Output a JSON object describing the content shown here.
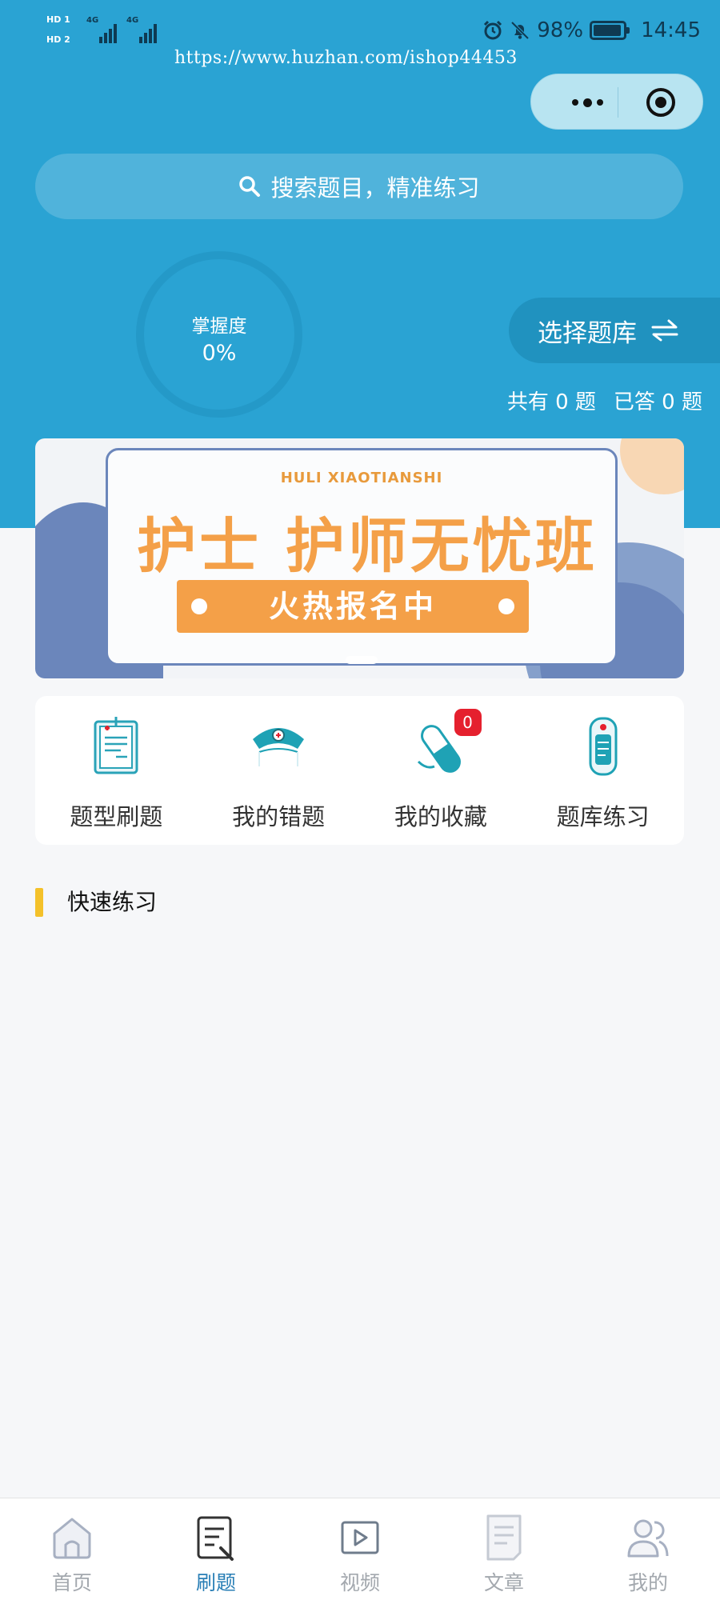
{
  "status_bar": {
    "hd1": "HD 1",
    "hd2": "HD 2",
    "net1": "4G",
    "net2": "4G",
    "battery": "98%",
    "time": "14:45"
  },
  "watermark": "https://www.huzhan.com/ishop44453",
  "search": {
    "placeholder": "搜索题目，精准练习"
  },
  "mastery": {
    "label": "掌握度",
    "value": "0%",
    "fraction": 0
  },
  "select_bank": {
    "label": "选择题库",
    "icon": "switch-arrows-icon"
  },
  "counts": {
    "total": "共有 0 题",
    "answered": "已答 0 题"
  },
  "banner": {
    "subtitle": "HULI XIAOTIANSHI",
    "headline": "护士 护师无忧班",
    "cta": "火热报名中"
  },
  "features": [
    {
      "label": "题型刷题",
      "icon": "clipboard-icon"
    },
    {
      "label": "我的错题",
      "icon": "nurse-cap-icon"
    },
    {
      "label": "我的收藏",
      "icon": "pill-capsule-icon",
      "badge": "0"
    },
    {
      "label": "题库练习",
      "icon": "phone-card-icon"
    }
  ],
  "quick_practice": {
    "title": "快速练习"
  },
  "tabs": [
    {
      "label": "首页",
      "icon": "home-icon",
      "active": false
    },
    {
      "label": "刷题",
      "icon": "edit-doc-icon",
      "active": true
    },
    {
      "label": "视频",
      "icon": "video-icon",
      "active": false
    },
    {
      "label": "文章",
      "icon": "article-icon",
      "active": false
    },
    {
      "label": "我的",
      "icon": "users-icon",
      "active": false
    }
  ],
  "colors": {
    "header_bg": "#2aa3d3",
    "accent_orange": "#f4a048",
    "quick_bar": "#f4c12a",
    "active_tab": "#2a7fb6",
    "badge": "#e5202e"
  }
}
